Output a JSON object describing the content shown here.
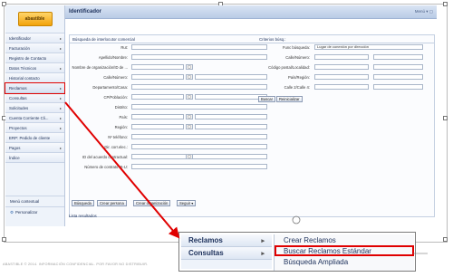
{
  "logo": {
    "text": "abastible"
  },
  "sidebar": {
    "items": [
      {
        "label": "Identificador",
        "arrow": "▸"
      },
      {
        "label": "Facturación",
        "arrow": "▸"
      },
      {
        "label": "Registro de Contacto",
        "arrow": ""
      },
      {
        "label": "Datos Técnicos",
        "arrow": "▸"
      },
      {
        "label": "Historial contacto",
        "arrow": ""
      },
      {
        "label": "Reclamos",
        "arrow": "▸"
      },
      {
        "label": "Consultas",
        "arrow": "▸"
      },
      {
        "label": "Solicitudes",
        "arrow": "▸"
      },
      {
        "label": "Cuenta Corriente Cli...",
        "arrow": "▸"
      },
      {
        "label": "Proyectos",
        "arrow": "▸"
      },
      {
        "label": "ERP: Pedido de cliente",
        "arrow": ""
      },
      {
        "label": "Pagos",
        "arrow": "▸"
      },
      {
        "label": "Índice",
        "arrow": ""
      }
    ],
    "bottom": {
      "menu_contextual": "Menú contextual",
      "personalizar": "Personalizar"
    }
  },
  "main": {
    "title": "Identificador",
    "tools": "Menú ▾  ▢",
    "panel_left_title": "Búsqueda de interlocutor comercial",
    "panel_right_title": "Criterios búsq.:",
    "left_fields": [
      "Rut:",
      "Apellido/Nombre:",
      "Nombre de organización/ID de ...",
      "Calle/Número:",
      "Departamento/Casa:",
      "CP/Población:",
      "Distrito:",
      "País:",
      "Región:",
      "Nº teléfono:",
      "Dir. corr.elec.:",
      "ID del acuerdo contractual:",
      "Número de contrato IS-U:"
    ],
    "right_fields": [
      "Func búsqueda:",
      "Calle/Número:",
      "Código postal/Localidad:",
      "País/Región:",
      "Calle 2/Calle 4:"
    ],
    "func_busqueda_value": "Lugar de conexión por dirección",
    "buttons": {
      "buscar": "Buscar",
      "reinicializar": "Reinicializar",
      "busqueda": "Búsqueda",
      "crear_persona": "Crear persona",
      "crear_organizacion": "Crear organización",
      "seguir": "Seguir ▾"
    },
    "results_title": "Lista resultados"
  },
  "zoom": {
    "menu_items": [
      "Reclamos",
      "Consultas"
    ],
    "submenu_items": [
      "Crear Reclamos",
      "Buscar Reclamos Estándar",
      "Búsqueda Ampliada"
    ]
  },
  "footer": "ABASTIBLE © 2014. INFORMACIÓN CONFIDENCIAL. POR FAVOR NO DISTRIBUIR.",
  "colors": {
    "highlight": "#e00000",
    "accent": "#1b2f5a"
  }
}
